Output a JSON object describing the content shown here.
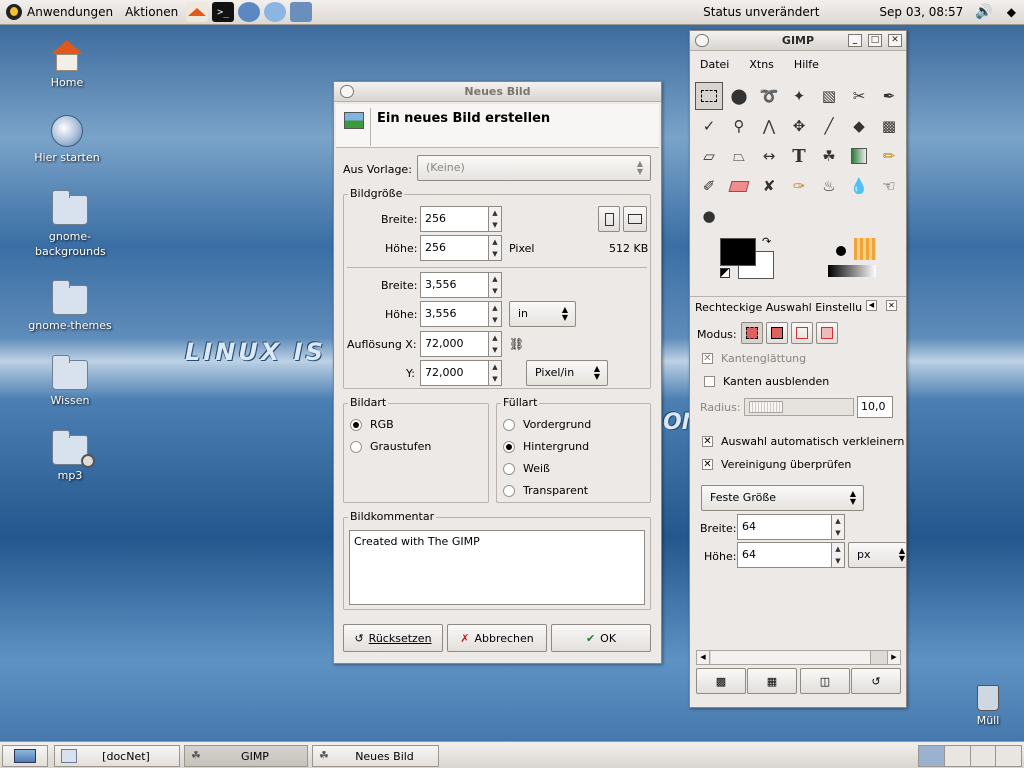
{
  "top_panel": {
    "menus": [
      "Anwendungen",
      "Aktionen"
    ],
    "launchers": [
      "home-launcher-icon",
      "terminal-launcher-icon",
      "network-launcher-icon",
      "web-launcher-icon",
      "screenshot-launcher-icon"
    ],
    "status": "Status unverändert",
    "datetime": "Sep 03, 08:57"
  },
  "desktop": {
    "icons": [
      {
        "label": "Home",
        "icon": "home-icon"
      },
      {
        "label": "Hier starten",
        "icon": "start-here-icon"
      },
      {
        "label": "gnome-backgrounds",
        "icon": "folder-icon"
      },
      {
        "label": "gnome-themes",
        "icon": "folder-icon"
      },
      {
        "label": "Wissen",
        "icon": "folder-icon"
      },
      {
        "label": "mp3",
        "icon": "folder-link-icon"
      }
    ],
    "trash_label": "Müll",
    "wallpaper_text": "LINUX IS",
    "wallpaper_text2": "OM"
  },
  "neues_bild": {
    "title": "Neues Bild",
    "heading": "Ein neues Bild erstellen",
    "template_label": "Aus Vorlage:",
    "template_value": "(Keine)",
    "size_frame": "Bildgröße",
    "width_label": "Breite:",
    "width_value": "256",
    "height_label": "Höhe:",
    "height_value": "256",
    "pixel_unit": "Pixel",
    "file_size": "512 KB",
    "width2_label": "Breite:",
    "width2_value": "3,556",
    "height2_label": "Höhe:",
    "height2_value": "3,556",
    "unit_value": "in",
    "res_x_label": "Auflösung X:",
    "res_x_value": "72,000",
    "res_y_label": "Y:",
    "res_y_value": "72,000",
    "res_unit": "Pixel/in",
    "image_type_frame": "Bildart",
    "image_types": [
      {
        "label": "RGB",
        "selected": true
      },
      {
        "label": "Graustufen",
        "selected": false
      }
    ],
    "fill_frame": "Füllart",
    "fill_types": [
      {
        "label": "Vordergrund",
        "selected": false
      },
      {
        "label": "Hintergrund",
        "selected": true
      },
      {
        "label": "Weiß",
        "selected": false
      },
      {
        "label": "Transparent",
        "selected": false
      }
    ],
    "comment_frame": "Bildkommentar",
    "comment": "Created with The GIMP",
    "buttons": {
      "reset": "Rücksetzen",
      "cancel": "Abbrechen",
      "ok": "OK"
    }
  },
  "gimp": {
    "title": "GIMP",
    "menu": [
      "Datei",
      "Xtns",
      "Hilfe"
    ],
    "tool_options_title": "Rechteckige Auswahl Einstellu",
    "mode_label": "Modus:",
    "antialias_label": "Kantenglättung",
    "antialias_checked": true,
    "feather_label": "Kanten ausblenden",
    "feather_checked": false,
    "radius_label": "Radius:",
    "radius_value": "10,0",
    "auto_shrink_label": "Auswahl automatisch verkleinern",
    "auto_shrink_checked": true,
    "merge_label": "Vereinigung überprüfen",
    "merge_checked": true,
    "fixed_size_value": "Feste Größe",
    "width_label": "Breite:",
    "width_value": "64",
    "height_label": "Höhe:",
    "height_value": "64",
    "unit_value": "px"
  },
  "taskbar": {
    "tasks": [
      "[docNet]",
      "GIMP",
      "Neues Bild"
    ]
  },
  "colors": {
    "title_bg": "#dcd8d3",
    "window_bg": "#ece9e6",
    "desktop": "#3a6ea4",
    "fg_color": "#000000",
    "bg_color": "#ffffff"
  }
}
